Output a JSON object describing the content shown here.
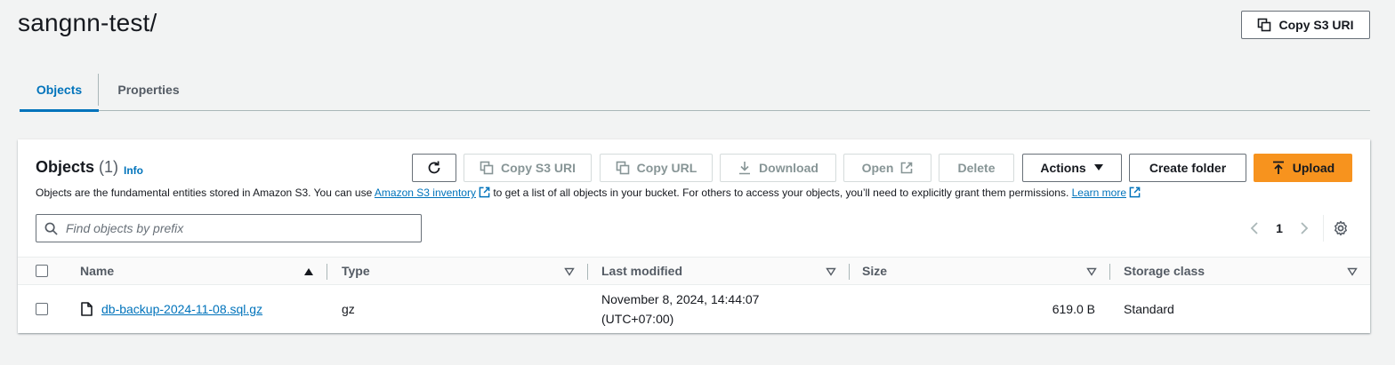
{
  "header": {
    "title": "sangnn-test/",
    "copy_uri_label": "Copy S3 URI"
  },
  "tabs": [
    {
      "label": "Objects",
      "active": true
    },
    {
      "label": "Properties",
      "active": false
    }
  ],
  "panel": {
    "title": "Objects",
    "count": "(1)",
    "info_label": "Info",
    "description": {
      "part1": "Objects are the fundamental entities stored in Amazon S3. You can use ",
      "link1": "Amazon S3 inventory",
      "part2": " to get a list of all objects in your bucket. For others to access your objects, you’ll need to explicitly grant them permissions. ",
      "link2": "Learn more"
    },
    "toolbar": {
      "refresh_icon": "refresh-icon",
      "copy_s3_uri": "Copy S3 URI",
      "copy_url": "Copy URL",
      "download": "Download",
      "open": "Open",
      "delete": "Delete",
      "actions": "Actions",
      "create_folder": "Create folder",
      "upload": "Upload"
    },
    "search": {
      "placeholder": "Find objects by prefix",
      "value": ""
    },
    "pagination": {
      "current_page": "1"
    },
    "table": {
      "columns": [
        "Name",
        "Type",
        "Last modified",
        "Size",
        "Storage class"
      ],
      "rows": [
        {
          "name": "db-backup-2024-11-08.sql.gz",
          "type": "gz",
          "last_modified_line1": "November 8, 2024, 14:44:07",
          "last_modified_line2": "(UTC+07:00)",
          "size": "619.0 B",
          "storage_class": "Standard"
        }
      ]
    }
  },
  "colors": {
    "accent": "#0073bb",
    "primary_button": "#f7931e",
    "background": "#f2f3f3"
  }
}
